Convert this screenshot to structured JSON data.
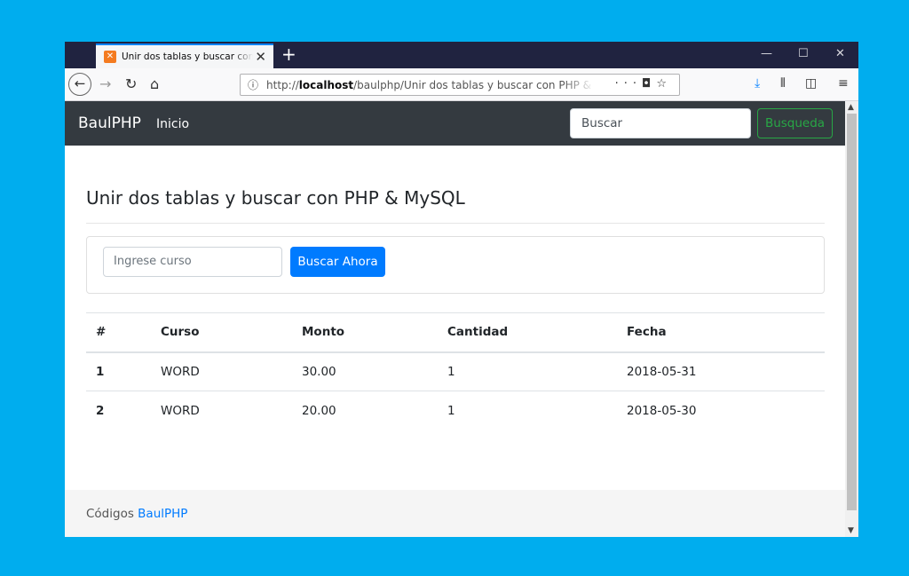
{
  "browser": {
    "tab_title": "Unir dos tablas y buscar con PHP & MySQL",
    "tab_close": "✕",
    "new_tab": "+",
    "url_host": "localhost",
    "url_prefix": "http://",
    "url_path": "/baulphp/Unir dos tablas y buscar con PHP & MySQL",
    "window_controls": [
      "—",
      "☐",
      "✕"
    ]
  },
  "navbar": {
    "brand": "BaulPHP",
    "link": "Inicio",
    "search_placeholder": "Buscar",
    "search_button": "Busqueda"
  },
  "page": {
    "title": "Unir dos tablas y buscar con PHP & MySQL",
    "course_placeholder": "Ingrese curso",
    "search_button": "Buscar Ahora"
  },
  "table": {
    "headers": [
      "#",
      "Curso",
      "Monto",
      "Cantidad",
      "Fecha"
    ],
    "rows": [
      [
        "1",
        "WORD",
        "30.00",
        "1",
        "2018-05-31"
      ],
      [
        "2",
        "WORD",
        "20.00",
        "1",
        "2018-05-30"
      ]
    ]
  },
  "footer": {
    "text": "Códigos",
    "link": "BaulPHP"
  },
  "icons": {
    "info": "info-icon",
    "back": "back-arrow-icon",
    "forward": "forward-arrow-icon",
    "reload": "reload-icon",
    "home": "home-icon"
  },
  "colors": {
    "desktop": "#00adee",
    "navbar": "#343a40",
    "primary": "#007bff",
    "success": "#28a745"
  }
}
